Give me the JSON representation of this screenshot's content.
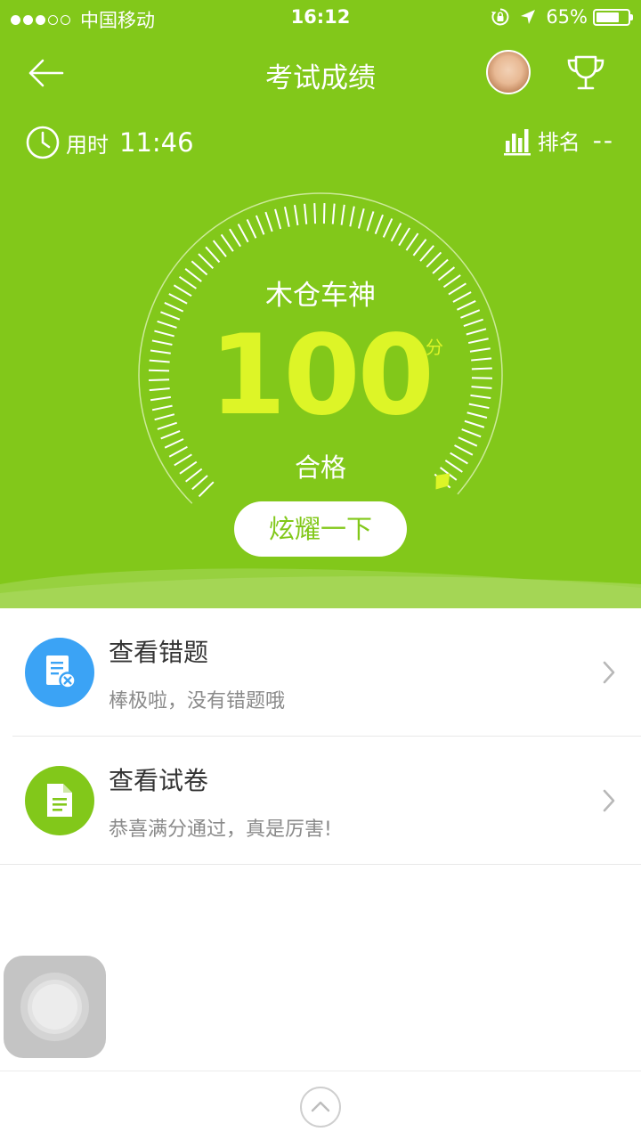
{
  "status_bar": {
    "carrier": "中国移动",
    "time": "16:12",
    "battery": "65%",
    "battery_level": 0.65,
    "signal_bars": 3,
    "signal_total": 5
  },
  "header": {
    "title": "考试成绩"
  },
  "info": {
    "time_label": "用时",
    "time_value": "11:46",
    "rank_label": "排名",
    "rank_value": "--"
  },
  "score": {
    "user_title": "木仓车神",
    "value": "100",
    "unit": "分",
    "result": "合格",
    "gauge_level": 1.0
  },
  "share_button": "炫耀一下",
  "list": [
    {
      "title": "查看错题",
      "subtitle": "棒极啦，没有错题哦",
      "icon": "wrong-question-icon",
      "icon_color": "#3ba3f5"
    },
    {
      "title": "查看试卷",
      "subtitle": "恭喜满分通过，真是厉害!",
      "icon": "paper-icon",
      "icon_color": "#82c81a"
    }
  ],
  "colors": {
    "primary_green": "#82c81a",
    "score_yellow": "#ddf527",
    "blue": "#3ba3f5"
  }
}
